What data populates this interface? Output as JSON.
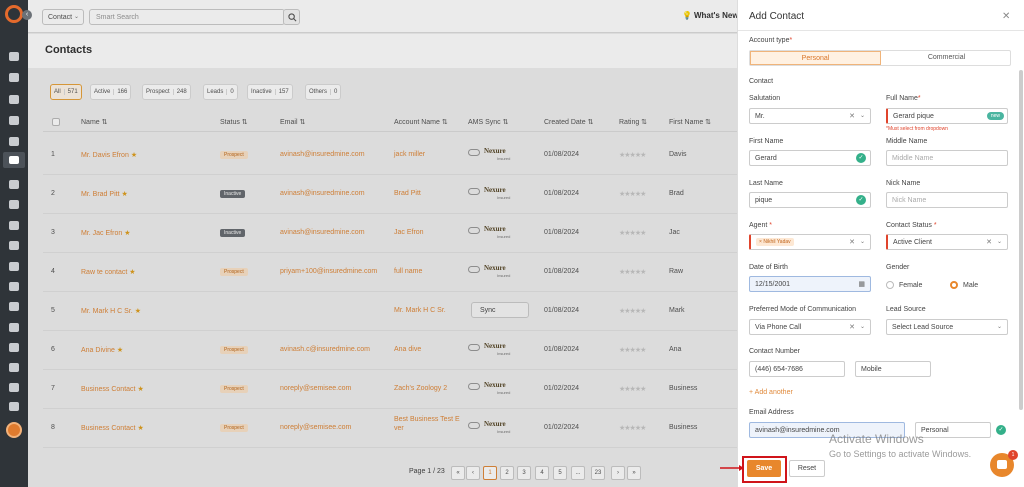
{
  "topbar": {
    "contact_type": "Contact",
    "search_placeholder": "Smart Search",
    "whats_new": "What's New"
  },
  "page": {
    "title": "Contacts"
  },
  "filters": [
    {
      "label": "All",
      "count": "571"
    },
    {
      "label": "Active",
      "count": "166"
    },
    {
      "label": "Prospect",
      "count": "248"
    },
    {
      "label": "Leads",
      "count": "0"
    },
    {
      "label": "Inactive",
      "count": "157"
    },
    {
      "label": "Others",
      "count": "0"
    }
  ],
  "table": {
    "headers": [
      "Name ⇅",
      "Status ⇅",
      "Email ⇅",
      "Account Name ⇅",
      "AMS Sync ⇅",
      "Created Date ⇅",
      "Rating ⇅",
      "First Name ⇅"
    ],
    "ams_logo": "Nexure",
    "ams_sub": "Insured",
    "sync_label": "Sync",
    "rating": "★★★★★",
    "rows": [
      {
        "num": "1",
        "name": "Mr. Davis Efron",
        "status": "Prospect",
        "email": "avinash@insuredmine.com",
        "account": "jack miller",
        "ams": "logo",
        "date": "01/08/2024",
        "first": "Davis"
      },
      {
        "num": "2",
        "name": "Mr. Brad Pitt",
        "status": "Inactive",
        "email": "avinash@insuredmine.com",
        "account": "Brad Pitt",
        "ams": "logo",
        "date": "01/08/2024",
        "first": "Brad"
      },
      {
        "num": "3",
        "name": "Mr. Jac Efron",
        "status": "Inactive",
        "email": "avinash@insuredmine.com",
        "account": "Jac Efron",
        "ams": "logo",
        "date": "01/08/2024",
        "first": "Jac"
      },
      {
        "num": "4",
        "name": "Raw te contact",
        "status": "Prospect",
        "email": "priyam+100@insuredmine.com",
        "account": "full name",
        "ams": "logo",
        "date": "01/08/2024",
        "first": "Raw"
      },
      {
        "num": "5",
        "name": "Mr. Mark H C Sr.",
        "status": "",
        "email": "",
        "account": "Mr. Mark H C Sr.",
        "ams": "sync",
        "date": "01/08/2024",
        "first": "Mark"
      },
      {
        "num": "6",
        "name": "Ana Divine",
        "status": "Prospect",
        "email": "avinash.c@insuredmine.com",
        "account": "Ana dive",
        "ams": "logo",
        "date": "01/08/2024",
        "first": "Ana"
      },
      {
        "num": "7",
        "name": "Business Contact",
        "status": "Prospect",
        "email": "noreply@semisee.com",
        "account": "Zach's Zoology 2",
        "ams": "logo",
        "date": "01/02/2024",
        "first": "Business"
      },
      {
        "num": "8",
        "name": "Business Contact",
        "status": "Prospect",
        "email": "noreply@semisee.com",
        "account": "Best Business Test E ver",
        "ams": "logo",
        "date": "01/02/2024",
        "first": "Business"
      }
    ]
  },
  "pagination": {
    "label": "Page 1 / 23",
    "pages": [
      "«",
      "‹",
      "1",
      "2",
      "3",
      "4",
      "5",
      "...",
      "23",
      "›",
      "»"
    ]
  },
  "drawer": {
    "title": "Add Contact",
    "account_type_label": "Account type",
    "account_types": [
      "Personal",
      "Commercial"
    ],
    "contact_section": "Contact",
    "salutation_label": "Salutation",
    "salutation_value": "Mr.",
    "full_name_label": "Full Name",
    "full_name_value": "Gerard pique",
    "full_name_badge": "new",
    "full_name_hint": "*Must select from dropdown",
    "first_name_label": "First Name",
    "first_name_value": "Gerard",
    "middle_name_label": "Middle Name",
    "middle_name_placeholder": "Middle Name",
    "last_name_label": "Last Name",
    "last_name_value": "pique",
    "nick_name_label": "Nick Name",
    "nick_name_placeholder": "Nick Name",
    "agent_label": "Agent",
    "agent_value": "Nikhil Yadav",
    "contact_status_label": "Contact Status",
    "contact_status_value": "Active Client",
    "dob_label": "Date of Birth",
    "dob_value": "12/15/2001",
    "gender_label": "Gender",
    "gender_options": [
      "Female",
      "Male"
    ],
    "pref_comm_label": "Preferred Mode of Communication",
    "pref_comm_value": "Via Phone Call",
    "lead_source_label": "Lead Source",
    "lead_source_value": "Select Lead Source",
    "contact_number_label": "Contact Number",
    "contact_number_value": "(446) 654-7686",
    "contact_number_type": "Mobile",
    "add_another": "+ Add another",
    "email_label": "Email Address",
    "email_value": "avinash@insuredmine.com",
    "email_type": "Personal",
    "save": "Save",
    "reset": "Reset"
  },
  "watermark": {
    "line1": "Activate Windows",
    "line2": "Go to Settings to activate Windows."
  },
  "chat": {
    "badge": "1"
  },
  "colors": {
    "accent": "#e8872c",
    "rail": "#2f3439",
    "error": "#e0442c",
    "success": "#34b08a",
    "highlight_box": "#d0141a"
  }
}
